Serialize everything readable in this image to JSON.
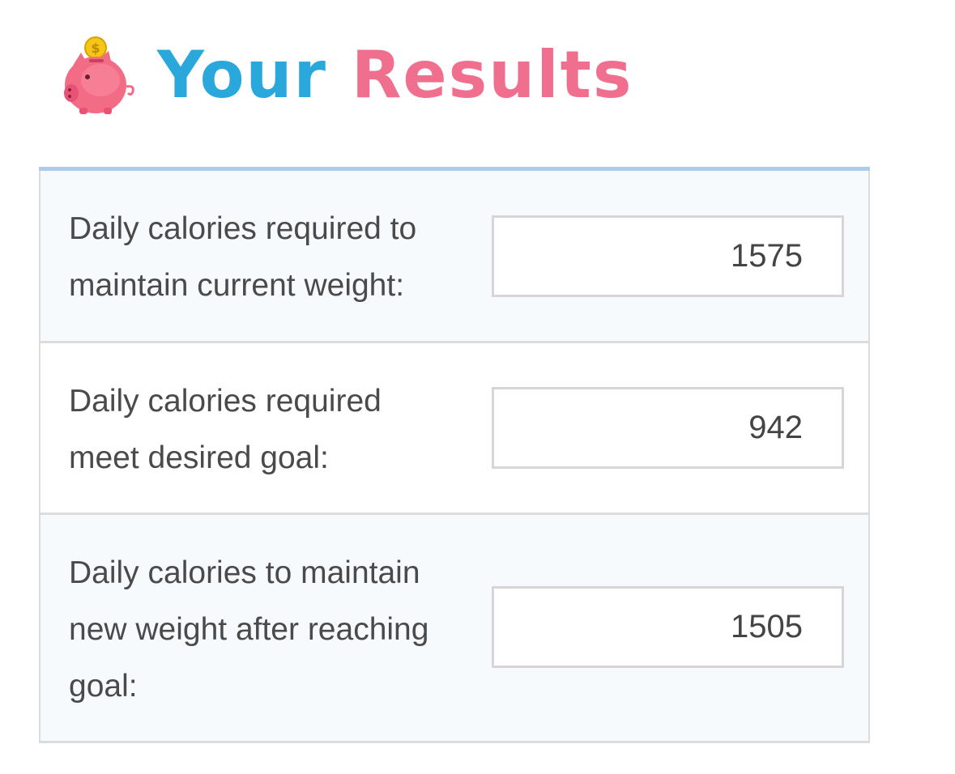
{
  "header": {
    "icon": "piggy-bank-icon",
    "title_part1": "Your",
    "title_part2": "Results",
    "title_part1_color": "#2aa8dc",
    "title_part2_color": "#f06f8f"
  },
  "results": [
    {
      "label": "Daily calories required to maintain current weight:",
      "value": "1575"
    },
    {
      "label": "Daily calories required meet desired goal:",
      "value": "942"
    },
    {
      "label": "Daily calories to maintain new weight after reaching goal:",
      "value": "1505"
    }
  ]
}
